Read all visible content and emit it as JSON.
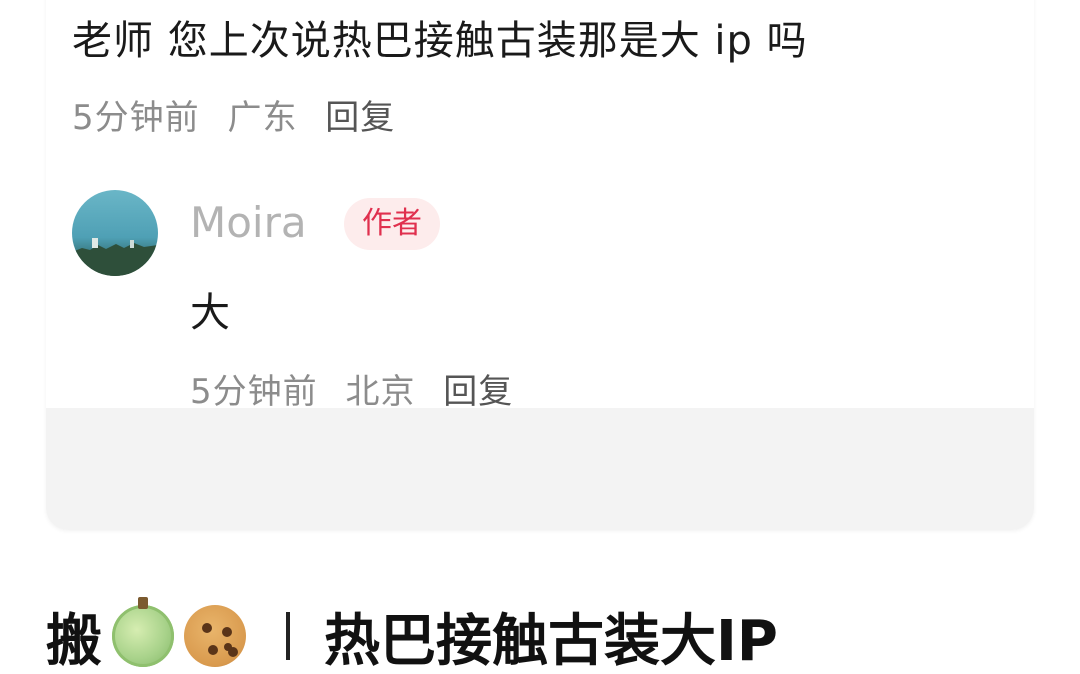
{
  "comment": {
    "text": "老师 您上次说热巴接触古装那是大 ip 吗",
    "time": "5分钟前",
    "location": "广东",
    "reply_label": "回复"
  },
  "reply": {
    "author_name": "Moira",
    "author_badge": "作者",
    "text": "大",
    "time": "5分钟前",
    "location": "北京",
    "reply_label": "回复"
  },
  "headline": {
    "prefix": "搬",
    "icons": [
      "melon-icon",
      "cookie-icon"
    ],
    "title": "热巴接触古装大IP"
  },
  "colors": {
    "badge_text": "#e0304e",
    "badge_bg": "#fdecec",
    "meta_text": "#8c8c8c",
    "author_name": "#b3b3b3"
  }
}
